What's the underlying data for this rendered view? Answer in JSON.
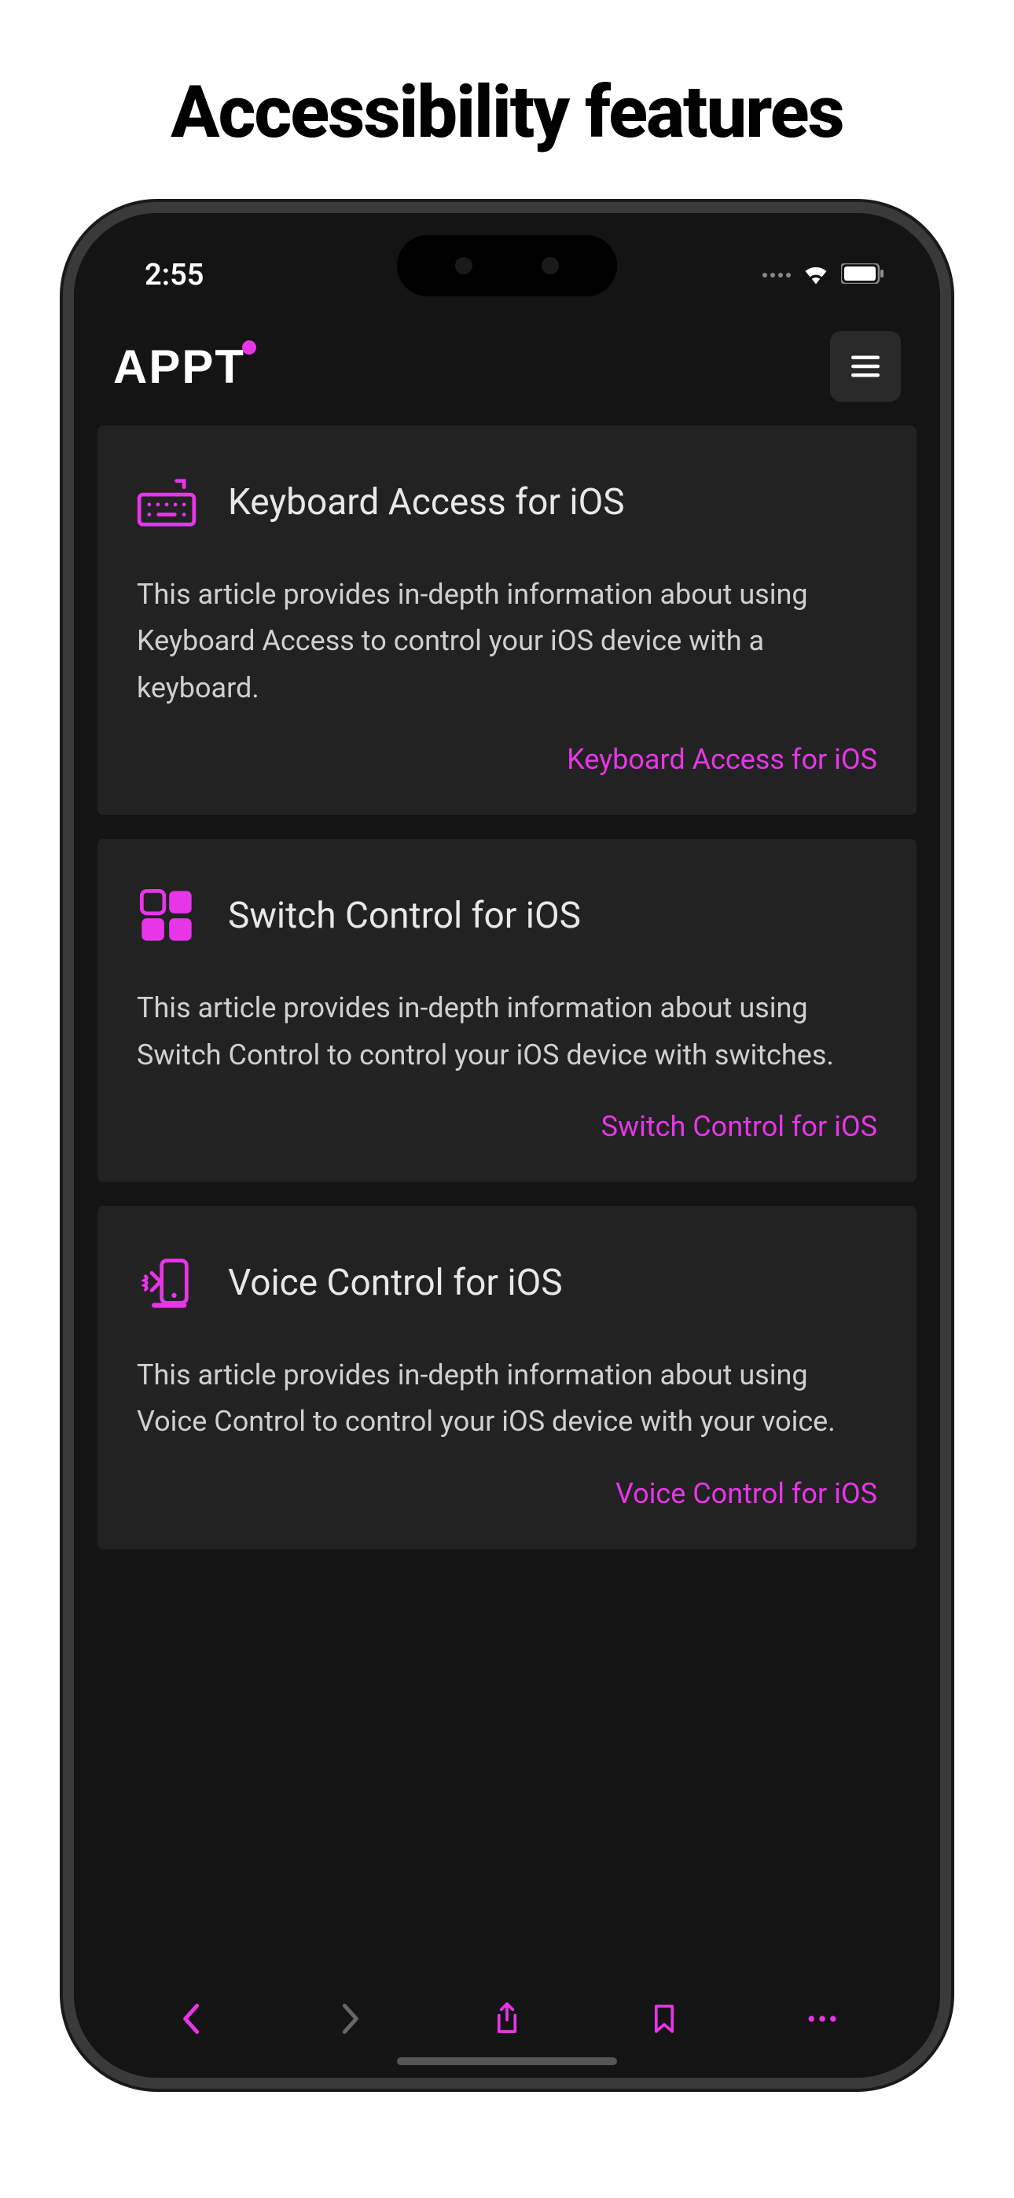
{
  "page_title": "Accessibility features",
  "status_bar": {
    "time": "2:55"
  },
  "header": {
    "logo_text": "APPT"
  },
  "cards": [
    {
      "icon": "keyboard-icon",
      "title": "Keyboard Access for iOS",
      "description": "This article provides in-depth information about using Keyboard Access to control your iOS device with a keyboard.",
      "link_text": "Keyboard Access for iOS"
    },
    {
      "icon": "switch-icon",
      "title": "Switch Control for iOS",
      "description": "This article provides in-depth information about using Switch Control to control your iOS device with switches.",
      "link_text": "Switch Control for iOS"
    },
    {
      "icon": "voice-icon",
      "title": "Voice Control for iOS",
      "description": "This article provides in-depth information about using Voice Control to control your iOS device with your voice.",
      "link_text": "Voice Control for iOS"
    }
  ],
  "colors": {
    "accent": "#e835e8",
    "background": "#141414",
    "card_bg": "#222",
    "text": "#e8e8e8",
    "text_secondary": "#d0d0d0"
  }
}
